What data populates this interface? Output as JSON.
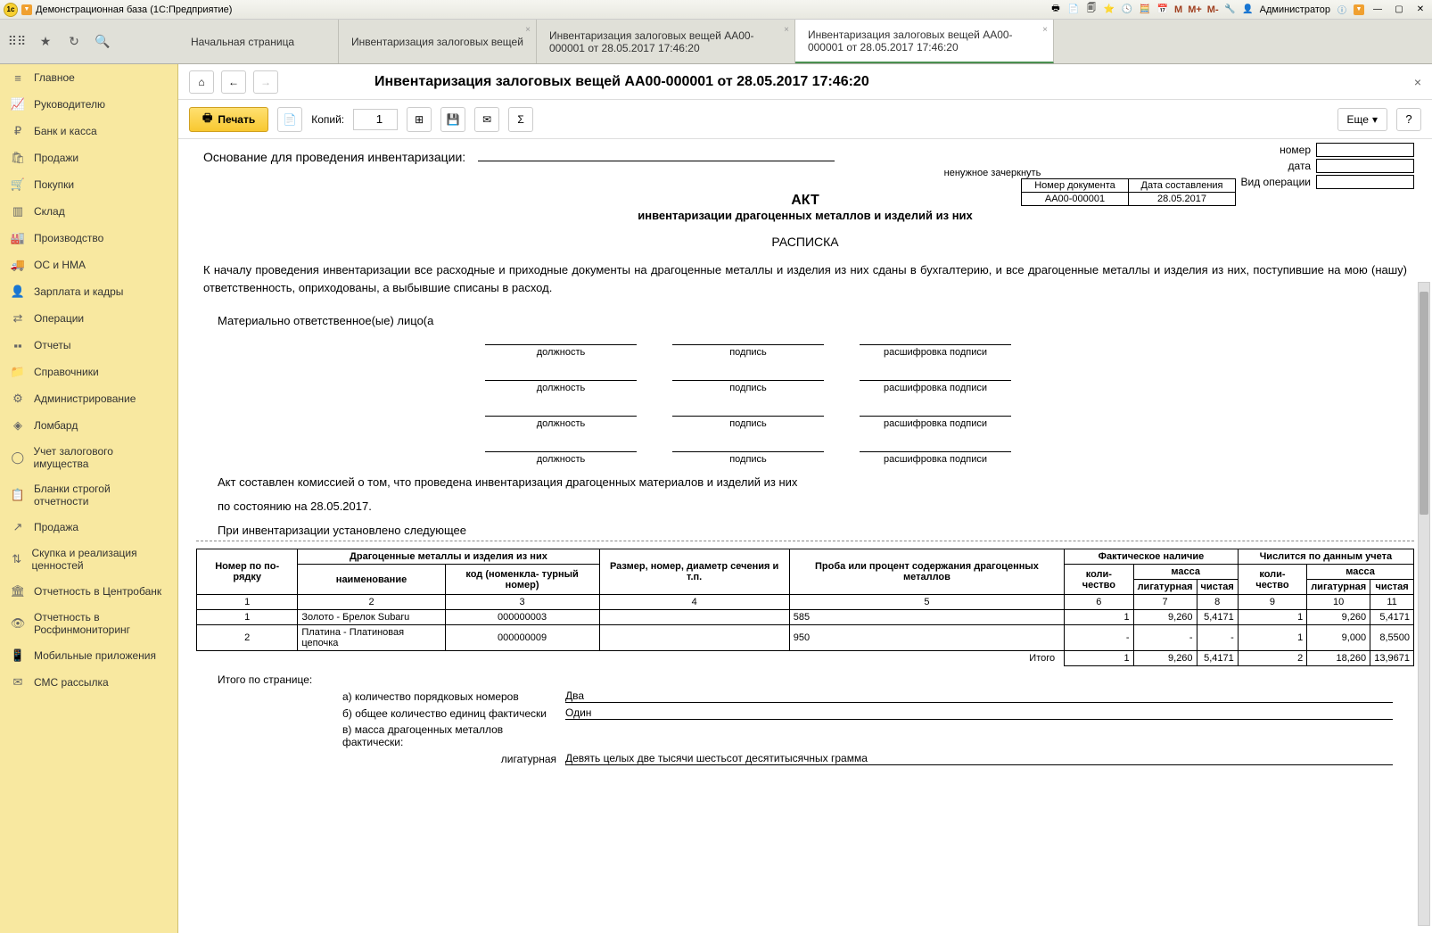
{
  "titlebar": {
    "app_title": "Демонстрационная база  (1С:Предприятие)",
    "m": "M",
    "m_plus": "M+",
    "m_minus": "M-",
    "user_label": "Администратор"
  },
  "tabs": {
    "t0": "Начальная страница",
    "t1": "Инвентаризация залоговых вещей",
    "t2": "Инвентаризация залоговых вещей АА00-000001 от 28.05.2017 17:46:20",
    "t3": "Инвентаризация залоговых вещей АА00-000001 от 28.05.2017 17:46:20"
  },
  "sidebar": {
    "items": [
      "Главное",
      "Руководителю",
      "Банк и касса",
      "Продажи",
      "Покупки",
      "Склад",
      "Производство",
      "ОС и НМА",
      "Зарплата и кадры",
      "Операции",
      "Отчеты",
      "Справочники",
      "Администрирование",
      "Ломбард",
      "Учет залогового имущества",
      "Бланки строгой отчетности",
      "Продажа",
      "Скупка и реализация ценностей",
      "Отчетность в Центробанк",
      "Отчетность в Росфинмониторинг",
      "Мобильные приложения",
      "СМС рассылка"
    ]
  },
  "content": {
    "title": "Инвентаризация залоговых вещей АА00-000001 от 28.05.2017 17:46:20"
  },
  "toolbar": {
    "print": "Печать",
    "copies_label": "Копий:",
    "copies_value": "1",
    "more": "Еще",
    "help": "?"
  },
  "doc": {
    "basis_label": "Основание для проведения инвентаризации:",
    "basis_sub": "ненужное зачеркнуть",
    "meta": {
      "number": "номер",
      "date": "дата",
      "operation": "Вид операции"
    },
    "akt": {
      "title": "АКТ",
      "subtitle": "инвентаризации драгоценных металлов и изделий из них",
      "doc_num_h": "Номер документа",
      "doc_date_h": "Дата составления",
      "doc_num": "АА00-000001",
      "doc_date": "28.05.2017"
    },
    "raspiska": "РАСПИСКА",
    "body_text": "К началу проведения инвентаризации все расходные и приходные документы на драгоценные металлы и изделия из них сданы в бухгалтерию, и все драгоценные металлы и изделия из них, поступившие на мою (нашу) ответственность, оприходованы, а выбывшие списаны в расход.",
    "resp_label": "Материально ответственное(ые) лицо(а",
    "sig": {
      "pos": "должность",
      "sign": "подпись",
      "decr": "расшифровка подписи"
    },
    "caption1": "Акт составлен комиссией о том, что проведена инвентаризация драгоценных материалов и изделий из них",
    "caption2": "по состоянию на 28.05.2017.",
    "caption3": "При инвентаризации установлено следующее",
    "table": {
      "h_num": "Номер по по- рядку",
      "h_metals": "Драгоценные металлы и изделия из них",
      "h_name": "наименование",
      "h_code": "код (номенкла- турный номер)",
      "h_size": "Размер, номер, диаметр сечения и т.п.",
      "h_probe": "Проба или процент содержания драгоценных металлов",
      "h_fact": "Фактическое наличие",
      "h_acc": "Числится по данным учета",
      "h_qty": "коли- чество",
      "h_mass": "масса",
      "h_lig": "лигатурная",
      "h_clean": "чистая",
      "c1": "1",
      "c2": "2",
      "c3": "3",
      "c4": "4",
      "c5": "5",
      "c6": "6",
      "c7": "7",
      "c8": "8",
      "c9": "9",
      "c10": "10",
      "c11": "11",
      "row1": {
        "n": "1",
        "name": "Золото - Брелок Subaru",
        "code": "000000003",
        "size": "",
        "probe": "585",
        "fq": "1",
        "fl": "9,260",
        "fc": "5,4171",
        "aq": "1",
        "al": "9,260",
        "ac": "5,4171"
      },
      "row2": {
        "n": "2",
        "name": "Платина - Платиновая цепочка",
        "code": "000000009",
        "size": "",
        "probe": "950",
        "fq": "-",
        "fl": "-",
        "fc": "-",
        "aq": "1",
        "al": "9,000",
        "ac": "8,5500"
      },
      "total_label": "Итого",
      "total": {
        "fq": "1",
        "fl": "9,260",
        "fc": "5,4171",
        "aq": "2",
        "al": "18,260",
        "ac": "13,9671"
      }
    },
    "page_total": {
      "label": "Итого по странице:",
      "a": "а) количество порядковых номеров",
      "a_val": "Два",
      "b": "б) общее количество единиц фактически",
      "b_val": "Один",
      "c": "в) масса драгоценных металлов фактически:",
      "c_sub": "лигатурная",
      "c_val": "Девять целых две тысячи шестьсот десятитысячных грамма"
    }
  }
}
